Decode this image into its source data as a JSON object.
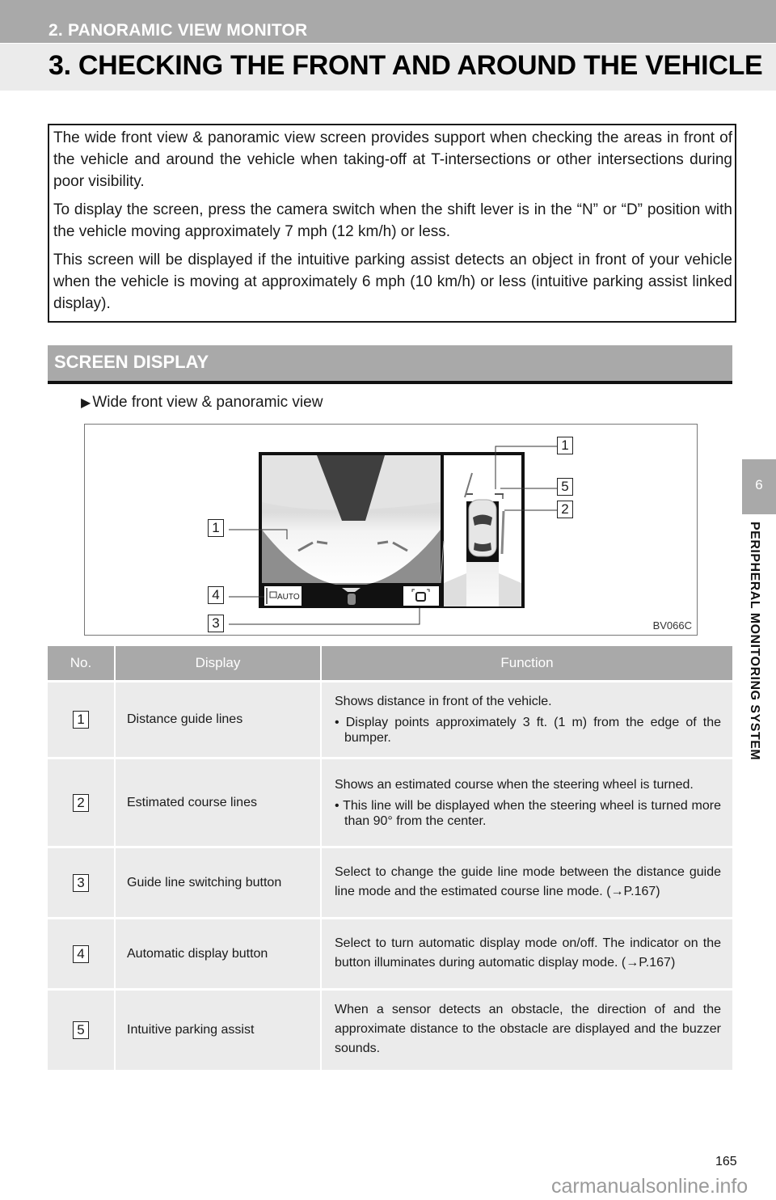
{
  "header": {
    "chapter": "2. PANORAMIC VIEW MONITOR",
    "title": "3. CHECKING THE FRONT AND AROUND THE VEHICLE"
  },
  "intro": {
    "paragraphs": [
      "The wide front view & panoramic view screen provides support when checking the areas in front of the vehicle and around the vehicle when taking-off at T-intersections or other intersections during poor visibility.",
      "To display the screen, press the camera switch when the shift lever is in the “N” or “D” position with the vehicle moving approximately 7 mph (12 km/h) or less.",
      "This screen will be displayed if the intuitive parking assist detects an object in front of your vehicle when the vehicle is moving at approximately 6 mph (10 km/h) or less (intuitive parking assist linked display)."
    ]
  },
  "section": {
    "title": "SCREEN DISPLAY"
  },
  "subheading": {
    "arrow_icon": "triangle-right",
    "label": "Wide front view & panoramic view"
  },
  "figure": {
    "code": "BV066C",
    "auto_button_label": "AUTO",
    "callouts": [
      "1",
      "4",
      "3",
      "1",
      "5",
      "2"
    ]
  },
  "table": {
    "headers": [
      "No.",
      "Display",
      "Function"
    ],
    "rows": [
      {
        "no": "1",
        "display": "Distance guide lines",
        "function": "Shows distance in front of the vehicle.",
        "bullet": "Display points approximately 3 ft. (1 m) from the edge of the bumper."
      },
      {
        "no": "2",
        "display": "Estimated course lines",
        "function": "Shows an estimated course when the steering wheel is turned.",
        "bullet": "This line will be displayed when the steering wheel is turned more than 90° from the center."
      },
      {
        "no": "3",
        "display": "Guide line switching button",
        "function": "Select to change the guide line mode between the distance guide line mode and the estimated course line mode. (→P.167)",
        "bullet": null
      },
      {
        "no": "4",
        "display": "Automatic display button",
        "function": "Select to turn automatic display mode on/off. The indicator on the button illuminates during automatic display mode. (→P.167)",
        "bullet": null
      },
      {
        "no": "5",
        "display": "Intuitive parking assist",
        "function": "When a sensor detects an obstacle, the direction of and the approximate distance to the obstacle are displayed and the buzzer sounds.",
        "bullet": null
      }
    ]
  },
  "side_tab": {
    "number": "6",
    "label": "PERIPHERAL MONITORING SYSTEM"
  },
  "footer": {
    "page_number": "165",
    "watermark": "carmanualsonline.info"
  }
}
